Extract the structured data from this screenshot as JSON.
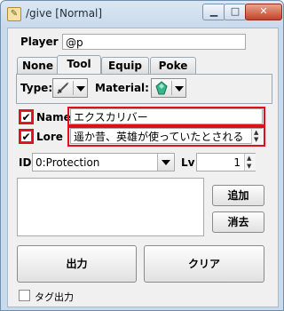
{
  "window": {
    "title": "/give [Normal]",
    "min_label": "▁",
    "max_label": "□",
    "close_label": "✕",
    "app_icon_glyph": "✎"
  },
  "player": {
    "label": "Player",
    "value": "@p"
  },
  "tabs": [
    {
      "label": "None"
    },
    {
      "label": "Tool"
    },
    {
      "label": "Equip"
    },
    {
      "label": "Poke"
    }
  ],
  "tool_panel": {
    "type_label": "Type:",
    "material_label": "Material:",
    "type_icon": "sword-icon",
    "material_icon": "emerald-icon"
  },
  "name": {
    "label": "Name",
    "checked": true,
    "value": "エクスカリバー"
  },
  "lore": {
    "label": "Lore",
    "checked": true,
    "value": "遥か昔、英雄が使っていたとされる"
  },
  "enchant": {
    "id_label": "ID",
    "id_value": "0:Protection",
    "lv_label": "Lv",
    "lv_value": "1"
  },
  "enchant_list": {
    "add_label": "追加",
    "delete_label": "消去"
  },
  "actions": {
    "output_label": "出力",
    "clear_label": "クリア"
  },
  "tag_output": {
    "label": "タグ出力",
    "checked": false
  },
  "colors": {
    "highlight": "#e0101a",
    "title_bg": "#c9daec"
  }
}
